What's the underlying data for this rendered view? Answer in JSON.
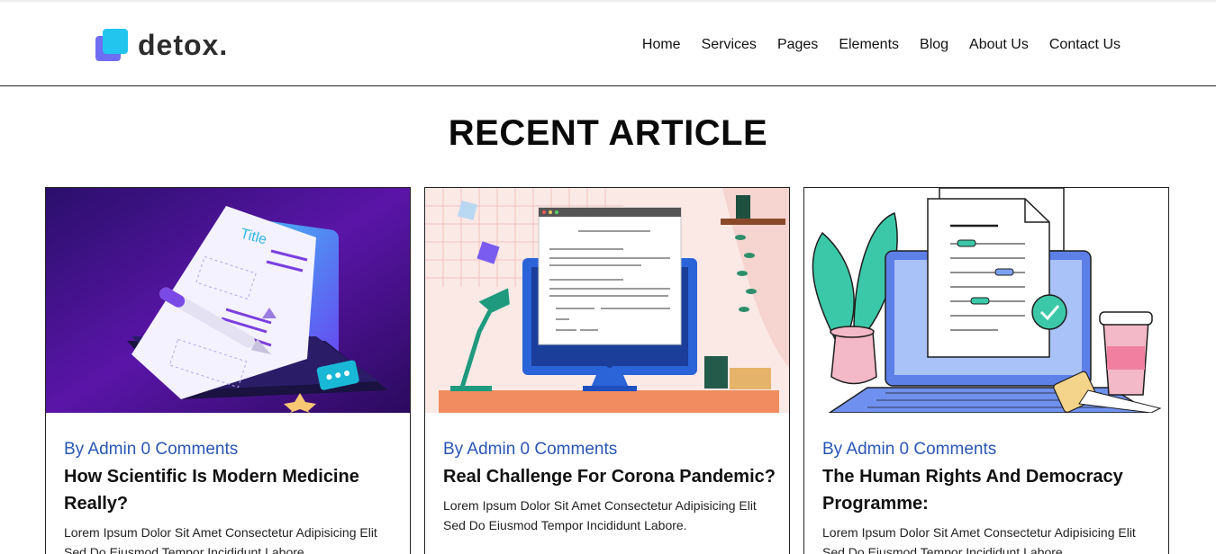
{
  "brand": {
    "name": "detox.",
    "colors": {
      "primary": "#22c5ee",
      "secondary": "#6f6ef2"
    }
  },
  "nav": {
    "items": [
      "Home",
      "Services",
      "Pages",
      "Elements",
      "Blog",
      "About Us",
      "Contact Us"
    ]
  },
  "section": {
    "title": "RECENT ARTICLE"
  },
  "articles": [
    {
      "meta": "By Admin 0 Comments",
      "title": "How Scientific Is Modern Medicine Really?",
      "excerpt": "Lorem Ipsum Dolor Sit Amet Consectetur Adipisicing Elit Sed Do Eiusmod Tempor Incididunt Labore.",
      "illustration": "laptop-document-pen-illustration"
    },
    {
      "meta": "By Admin 0 Comments",
      "title": "Real Challenge For Corona Pandemic?",
      "excerpt": "Lorem Ipsum Dolor Sit Amet Consectetur Adipisicing Elit Sed Do Eiusmod Tempor Incididunt Labore.",
      "illustration": "desk-monitor-lamp-illustration"
    },
    {
      "meta": "By Admin 0 Comments",
      "title": "The Human Rights And Democracy Programme:",
      "excerpt": "Lorem Ipsum Dolor Sit Amet Consectetur Adipisicing Elit Sed Do Eiusmod Tempor Incididunt Labore.",
      "illustration": "laptop-document-plant-coffee-illustration"
    }
  ]
}
